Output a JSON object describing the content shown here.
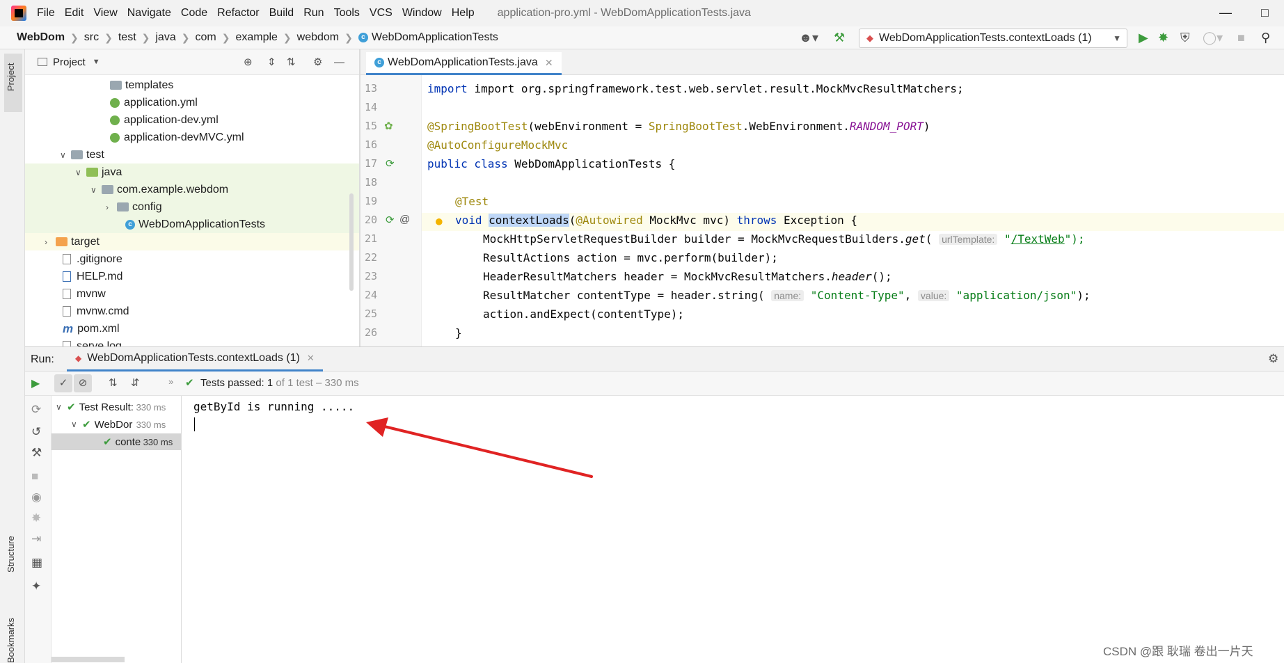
{
  "menu": {
    "items": [
      "File",
      "Edit",
      "View",
      "Navigate",
      "Code",
      "Refactor",
      "Build",
      "Run",
      "Tools",
      "VCS",
      "Window",
      "Help"
    ],
    "title": "application-pro.yml - WebDomApplicationTests.java"
  },
  "breadcrumb": [
    "WebDom",
    "src",
    "test",
    "java",
    "com",
    "example",
    "webdom",
    "WebDomApplicationTests"
  ],
  "run_config": {
    "label": "WebDomApplicationTests.contextLoads (1)"
  },
  "left_strip": {
    "project": "Project",
    "structure": "Structure",
    "bookmarks": "Bookmarks"
  },
  "project_panel": {
    "title": "Project",
    "tree": [
      {
        "label": "templates",
        "icon": "folder"
      },
      {
        "label": "application.yml",
        "icon": "spring-config"
      },
      {
        "label": "application-dev.yml",
        "icon": "spring-config"
      },
      {
        "label": "application-devMVC.yml",
        "icon": "spring-config"
      },
      {
        "label": "test",
        "icon": "folder"
      },
      {
        "label": "java",
        "icon": "test-source-folder"
      },
      {
        "label": "com.example.webdom",
        "icon": "package"
      },
      {
        "label": "config",
        "icon": "package"
      },
      {
        "label": "WebDomApplicationTests",
        "icon": "class"
      },
      {
        "label": "target",
        "icon": "excluded-folder"
      },
      {
        "label": ".gitignore",
        "icon": "file"
      },
      {
        "label": "HELP.md",
        "icon": "markdown"
      },
      {
        "label": "mvnw",
        "icon": "file"
      },
      {
        "label": "mvnw.cmd",
        "icon": "file"
      },
      {
        "label": "pom.xml",
        "icon": "maven"
      },
      {
        "label": "serve.log",
        "icon": "file"
      }
    ]
  },
  "editor": {
    "tab": "WebDomApplicationTests.java",
    "line_numbers": [
      "13",
      "14",
      "15",
      "16",
      "17",
      "18",
      "19",
      "20",
      "21",
      "22",
      "23",
      "24",
      "25",
      "26"
    ],
    "code": {
      "l13": "import org.springframework.test.web.servlet.result.MockMvcResultMatchers;",
      "l15a": "@SpringBootTest",
      "l15b": "(webEnvironment = ",
      "l15c": "SpringBootTest",
      "l15d": ".WebEnvironment.",
      "l15e": "RANDOM_PORT",
      "l15f": ")",
      "l16": "@AutoConfigureMockMvc",
      "l17a": "public class",
      "l17b": " WebDomApplicationTests {",
      "l19": "@Test",
      "l20a": "void",
      "l20b": "contextLoads",
      "l20c": "(",
      "l20d": "@Autowired",
      "l20e": " MockMvc mvc) ",
      "l20f": "throws",
      "l20g": " Exception {",
      "l21a": "MockHttpServletRequestBuilder builder = MockMvcRequestBuilders.",
      "l21b": "get",
      "l21c": "(",
      "l21hint": "urlTemplate:",
      "l21d": "\"",
      "l21e": "/TextWeb",
      "l21f": "\");",
      "l22": "ResultActions action = mvc.perform(builder);",
      "l23a": "HeaderResultMatchers header = MockMvcResultMatchers.",
      "l23b": "header",
      "l23c": "();",
      "l24a": "ResultMatcher contentType = header.string(",
      "l24hint1": "name:",
      "l24b": "\"Content-Type\"",
      "l24c": ",",
      "l24hint2": "value:",
      "l24d": "\"application/json\"",
      "l24e": ");",
      "l25": "action.andExpect(contentType);",
      "l26": "}"
    }
  },
  "run_panel": {
    "label": "Run:",
    "tab": "WebDomApplicationTests.contextLoads (1)",
    "status_prefix": "Tests passed:",
    "status_count": "1",
    "status_suffix": "of 1 test – 330 ms",
    "tree": [
      {
        "label": "Test Result:",
        "time": "330 ms"
      },
      {
        "label": "WebDor",
        "time": "330 ms"
      },
      {
        "label": "conte",
        "time": "330 ms"
      }
    ],
    "console": "getById is running ....."
  },
  "watermark": "CSDN @跟 耿瑞 卷出一片天",
  "colors": {
    "accent": "#4083c9",
    "pass": "#3c9b3c",
    "annotation_arrow": "#e02323"
  }
}
